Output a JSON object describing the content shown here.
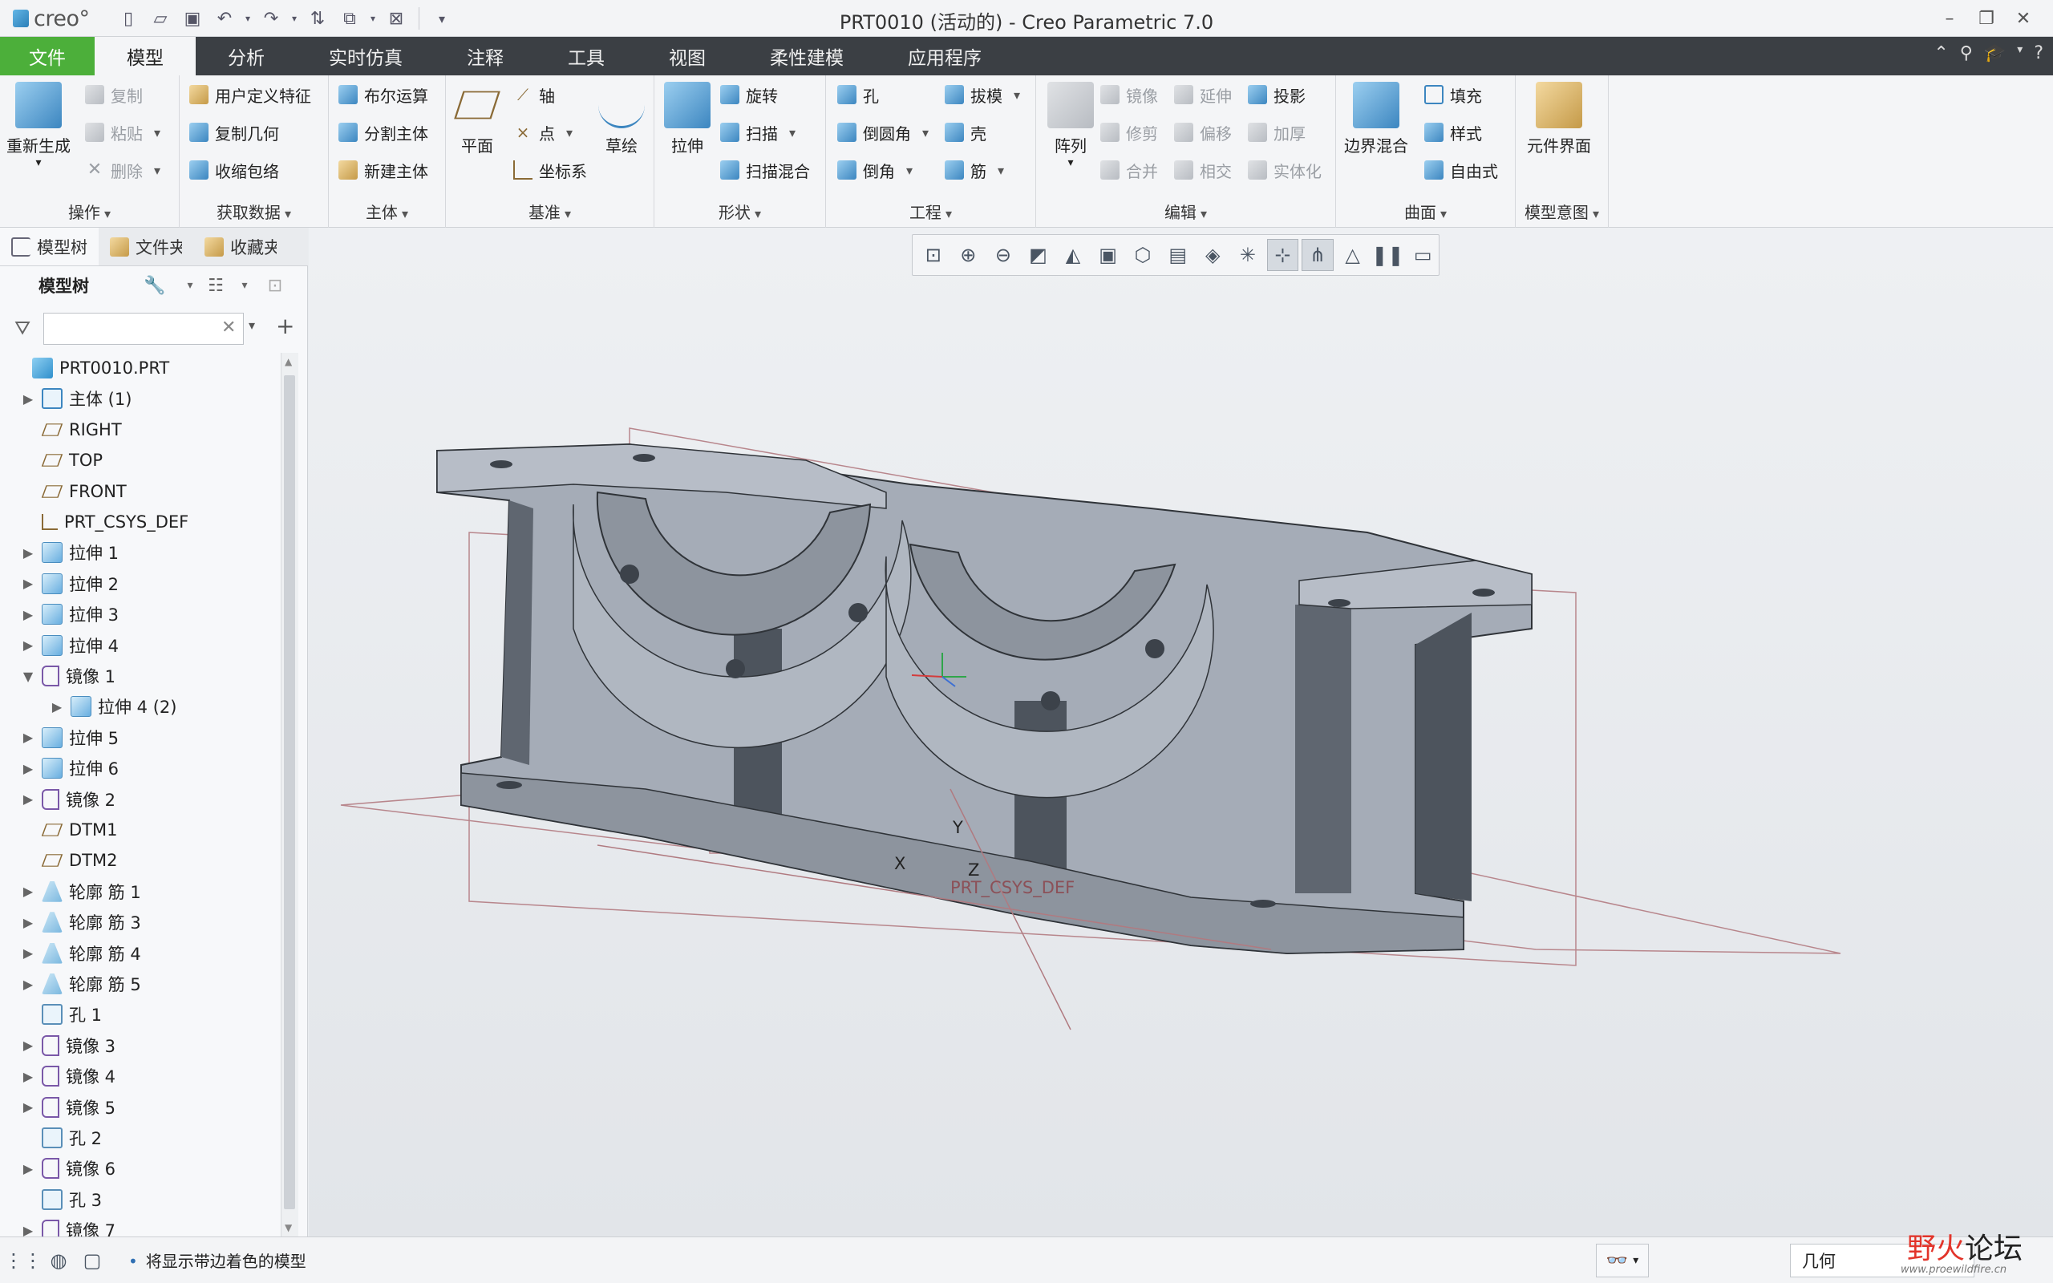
{
  "app": {
    "logo_text": "creo°",
    "title": "PRT0010 (活动的) - Creo Parametric 7.0"
  },
  "quick_access": [
    "new-icon",
    "open-icon",
    "save-icon",
    "undo-icon",
    "redo-icon",
    "regenerate-icon",
    "windows-icon",
    "close-window-icon",
    "customize-icon"
  ],
  "tabs": [
    "文件",
    "模型",
    "分析",
    "实时仿真",
    "注释",
    "工具",
    "视图",
    "柔性建模",
    "应用程序"
  ],
  "active_tab": "模型",
  "ribbon": {
    "operations": {
      "label": "操作",
      "regen": "重新生成",
      "copy": "复制",
      "paste": "粘贴",
      "delete": "删除"
    },
    "get_data": {
      "label": "获取数据",
      "udf": "用户定义特征",
      "copy_geom": "复制几何",
      "shrinkwrap": "收缩包络"
    },
    "body": {
      "label": "主体",
      "boolean": "布尔运算",
      "split": "分割主体",
      "new_body": "新建主体"
    },
    "datum": {
      "label": "基准",
      "plane": "平面",
      "axis": "轴",
      "point": "点",
      "csys": "坐标系",
      "sketch": "草绘"
    },
    "shapes": {
      "label": "形状",
      "extrude": "拉伸",
      "revolve": "旋转",
      "sweep": "扫描",
      "swept_blend": "扫描混合"
    },
    "engineering": {
      "label": "工程",
      "hole": "孔",
      "round": "倒圆角",
      "chamfer": "倒角",
      "draft": "拔模",
      "shell": "壳",
      "rib": "筋"
    },
    "editing": {
      "label": "编辑",
      "pattern": "阵列",
      "mirror": "镜像",
      "trim": "修剪",
      "merge": "合并",
      "extend": "延伸",
      "offset": "偏移",
      "intersect": "相交",
      "project": "投影",
      "thicken": "加厚",
      "solidify": "实体化"
    },
    "surfaces": {
      "label": "曲面",
      "boundary_blend": "边界混合",
      "fill": "填充",
      "style": "样式",
      "freestyle": "自由式"
    },
    "model_intent": {
      "label": "模型意图",
      "component_interface": "元件界面"
    }
  },
  "panel": {
    "tabs": [
      "模型树",
      "文件夹",
      "收藏夹"
    ],
    "tree_header": "模型树",
    "filter_placeholder": "",
    "tree": [
      {
        "label": "PRT0010.PRT",
        "icon": "part",
        "indent": 0,
        "exp": ""
      },
      {
        "label": "主体 (1)",
        "icon": "body",
        "indent": 1,
        "exp": "▶"
      },
      {
        "label": "RIGHT",
        "icon": "plane",
        "indent": 1,
        "exp": ""
      },
      {
        "label": "TOP",
        "icon": "plane",
        "indent": 1,
        "exp": ""
      },
      {
        "label": "FRONT",
        "icon": "plane",
        "indent": 1,
        "exp": ""
      },
      {
        "label": "PRT_CSYS_DEF",
        "icon": "csys",
        "indent": 1,
        "exp": ""
      },
      {
        "label": "拉伸 1",
        "icon": "ext",
        "indent": 1,
        "exp": "▶"
      },
      {
        "label": "拉伸 2",
        "icon": "ext",
        "indent": 1,
        "exp": "▶"
      },
      {
        "label": "拉伸 3",
        "icon": "ext",
        "indent": 1,
        "exp": "▶"
      },
      {
        "label": "拉伸 4",
        "icon": "ext",
        "indent": 1,
        "exp": "▶"
      },
      {
        "label": "镜像 1",
        "icon": "mirror",
        "indent": 1,
        "exp": "▼"
      },
      {
        "label": "拉伸 4 (2)",
        "icon": "ext",
        "indent": 2,
        "exp": "▶"
      },
      {
        "label": "拉伸 5",
        "icon": "ext",
        "indent": 1,
        "exp": "▶"
      },
      {
        "label": "拉伸 6",
        "icon": "ext",
        "indent": 1,
        "exp": "▶"
      },
      {
        "label": "镜像 2",
        "icon": "mirror",
        "indent": 1,
        "exp": "▶"
      },
      {
        "label": "DTM1",
        "icon": "plane",
        "indent": 1,
        "exp": ""
      },
      {
        "label": "DTM2",
        "icon": "plane",
        "indent": 1,
        "exp": ""
      },
      {
        "label": "轮廓 筋 1",
        "icon": "rib",
        "indent": 1,
        "exp": "▶"
      },
      {
        "label": "轮廓 筋 3",
        "icon": "rib",
        "indent": 1,
        "exp": "▶"
      },
      {
        "label": "轮廓 筋 4",
        "icon": "rib",
        "indent": 1,
        "exp": "▶"
      },
      {
        "label": "轮廓 筋 5",
        "icon": "rib",
        "indent": 1,
        "exp": "▶"
      },
      {
        "label": "孔 1",
        "icon": "hole",
        "indent": 1,
        "exp": ""
      },
      {
        "label": "镜像 3",
        "icon": "mirror",
        "indent": 1,
        "exp": "▶"
      },
      {
        "label": "镜像 4",
        "icon": "mirror",
        "indent": 1,
        "exp": "▶"
      },
      {
        "label": "镜像 5",
        "icon": "mirror",
        "indent": 1,
        "exp": "▶"
      },
      {
        "label": "孔 2",
        "icon": "hole",
        "indent": 1,
        "exp": ""
      },
      {
        "label": "镜像 6",
        "icon": "mirror",
        "indent": 1,
        "exp": "▶"
      },
      {
        "label": "孔 3",
        "icon": "hole",
        "indent": 1,
        "exp": ""
      },
      {
        "label": "镜像 7",
        "icon": "mirror",
        "indent": 1,
        "exp": "▶"
      }
    ]
  },
  "graphics": {
    "csys_label": "PRT_CSYS_DEF",
    "axis_x": "X",
    "axis_y": "Y",
    "axis_z": "Z",
    "view_toolbar": [
      "refit-icon",
      "zoom-in-icon",
      "zoom-out-icon",
      "repaint-icon",
      "perspective-icon",
      "display-style-icon",
      "saved-orientations-icon",
      "view-manager-icon",
      "section-icon",
      "datum-display-icon",
      "spin-center-icon",
      "annotation-display-icon",
      "appearance-icon",
      "pause-icon",
      "selection-icon"
    ]
  },
  "statusbar": {
    "message": "将显示带边着色的模型",
    "selection_filter": "几何"
  },
  "watermark": {
    "top_red": "野火",
    "top_dark": "论坛",
    "url": "www.proewildfire.cn"
  },
  "colors": {
    "file_tab": "#4caf3a",
    "tab_bar": "#3b3f44",
    "model_face": "#a6adb8",
    "model_dark": "#5f6670",
    "datum_line": "#b57a82"
  }
}
